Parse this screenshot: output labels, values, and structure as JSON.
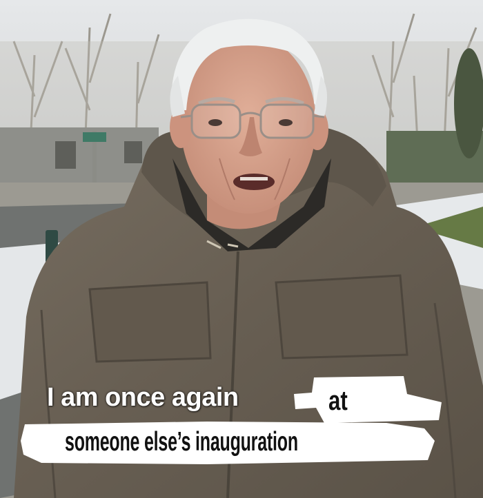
{
  "caption": {
    "line1": "I am once again",
    "line1_handwritten_word": "at",
    "line2": "someone else’s inauguration"
  },
  "colors": {
    "sky": "#dfe2e4",
    "jacket": "#6b6256",
    "hair": "#eceeee",
    "skin": "#d6a590",
    "snow": "#e7eaec",
    "whiteout": "#ffffff"
  }
}
